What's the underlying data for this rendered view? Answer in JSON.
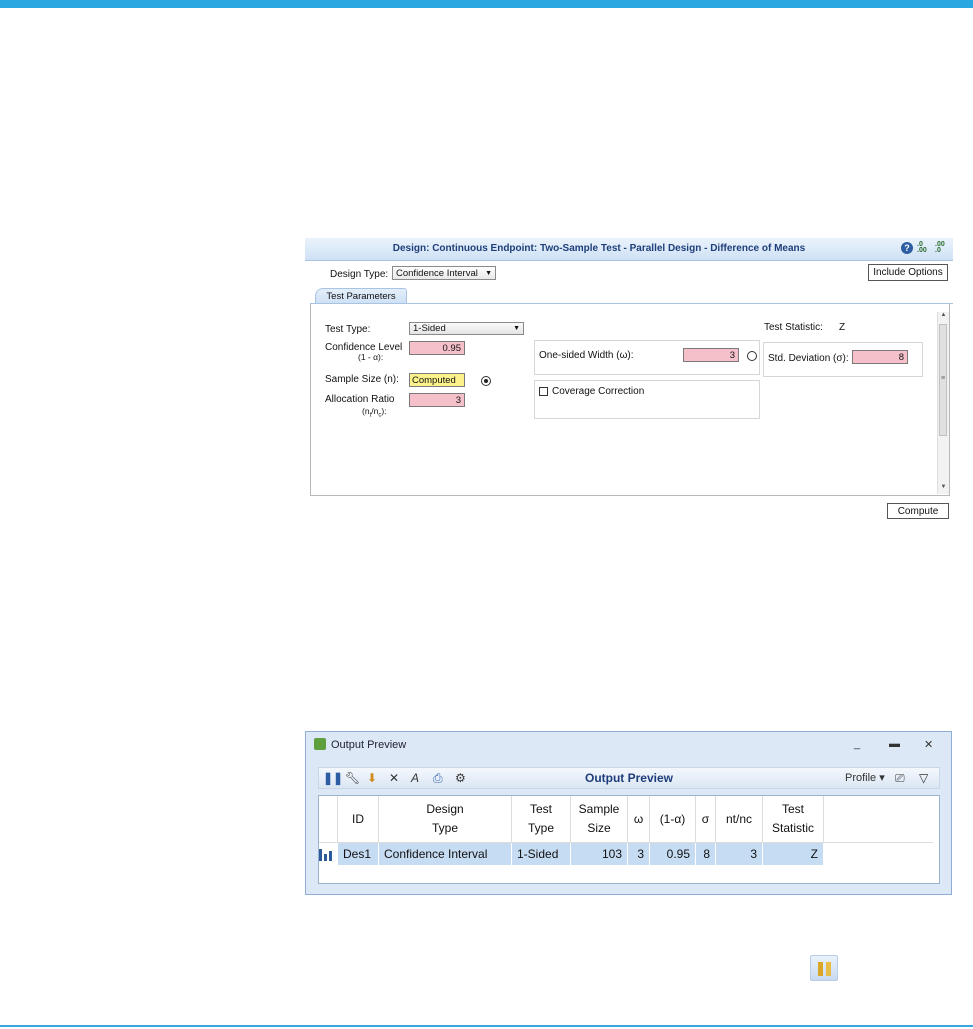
{
  "design": {
    "title": "Design: Continuous Endpoint: Two-Sample Test - Parallel Design - Difference of Means",
    "design_type_label": "Design Type:",
    "design_type_value": "Confidence Interval",
    "include_options": "Include Options",
    "tab_label": "Test Parameters",
    "test_type_label": "Test Type:",
    "test_type_value": "1-Sided",
    "confidence_level_label": "Confidence Level",
    "confidence_level_sub": "(1 - α):",
    "confidence_level_value": "0.95",
    "sample_size_label": "Sample Size (n):",
    "sample_size_value": "Computed",
    "allocation_ratio_label": "Allocation Ratio",
    "allocation_ratio_sub_n": "(n",
    "allocation_ratio_sub_t": "t",
    "allocation_ratio_sub_slash": "/n",
    "allocation_ratio_sub_c": "c",
    "allocation_ratio_sub_end": "):",
    "allocation_ratio_value": "3",
    "width_label": "One-sided Width (ω):",
    "width_value": "3",
    "coverage_label": "Coverage Correction",
    "test_statistic_label": "Test Statistic:",
    "test_statistic_value": "Z",
    "std_dev_label": "Std. Deviation (σ):",
    "std_dev_value": "8",
    "compute_label": "Compute"
  },
  "output_preview": {
    "window_title": "Output Preview",
    "toolbar_title": "Output Preview",
    "profile_label": "Profile",
    "columns": [
      "ID",
      "Design\nType",
      "Test\nType",
      "Sample\nSize",
      "ω",
      "(1-α)",
      "σ",
      "nt/nc",
      "Test\nStatistic"
    ],
    "row": {
      "id": "Des1",
      "design_type": "Confidence Interval",
      "test_type": "1-Sided",
      "sample_size": "103",
      "omega": "3",
      "conf": "0.95",
      "sigma": "8",
      "ratio": "3",
      "test_statistic": "Z"
    }
  },
  "colors": {
    "accent": "#29a8e0",
    "input_pink": "#f6c0cb",
    "input_yellow": "#fbf28b",
    "grid_selected": "#c6dcf2"
  }
}
